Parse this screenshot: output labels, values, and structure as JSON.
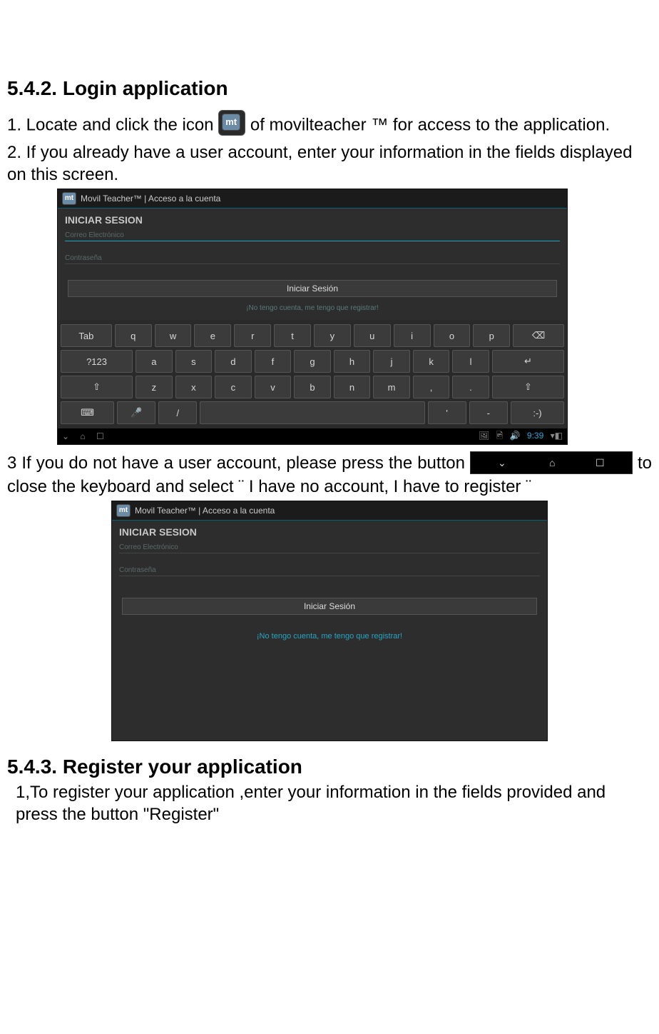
{
  "section1": {
    "heading": "5.4.2. Login application",
    "step1_a": "1. Locate and click the icon ",
    "step1_b": " of movilteacher ™ for access to the application.",
    "step2": "2. If you already have a user account, enter your information in the fields displayed on this screen."
  },
  "ss1": {
    "window_title": "Movil Teacher™ | Acceso a la cuenta",
    "login_title": "INICIAR SESION",
    "email_label": "Correo Electrónico",
    "password_label": "Contraseña",
    "login_button": "Iniciar Sesión",
    "register_hint_clipped": "¡No tengo cuenta, me tengo que registrar!",
    "keyboard": {
      "row1": [
        "Tab",
        "q",
        "w",
        "e",
        "r",
        "t",
        "y",
        "u",
        "i",
        "o",
        "p",
        "⌫"
      ],
      "row2": [
        "?123",
        "a",
        "s",
        "d",
        "f",
        "g",
        "h",
        "j",
        "k",
        "l",
        "↵"
      ],
      "row3": [
        "⇧",
        "z",
        "x",
        "c",
        "v",
        "b",
        "n",
        "m",
        ",",
        ".",
        "⇧"
      ],
      "row4": [
        "⌨",
        "🎤",
        "/",
        "",
        "'",
        "-",
        ":-)"
      ]
    },
    "status": {
      "nav": [
        "⌄",
        "⌂",
        "☐"
      ],
      "right_icons": [
        "🖼",
        "🖻",
        "🔊"
      ],
      "clock": "9:39",
      "signal": "▾◧"
    }
  },
  "section2": {
    "step3_a": "3 If you do not have a user account, please press the button ",
    "step3_b": " to close the keyboard and select ¨ I have no account, I have to register ¨"
  },
  "ss2": {
    "window_title": "Movil Teacher™ | Acceso a la cuenta",
    "login_title": "INICIAR SESION",
    "email_label": "Correo Electrónico",
    "password_label": "Contraseña",
    "login_button": "Iniciar Sesión",
    "register_link": "¡No tengo cuenta, me tengo que registrar!"
  },
  "section3": {
    "heading": "5.4.3. Register your application",
    "step1": "1,To register your application ,enter your information in the fields provided and press the button \"Register\""
  }
}
